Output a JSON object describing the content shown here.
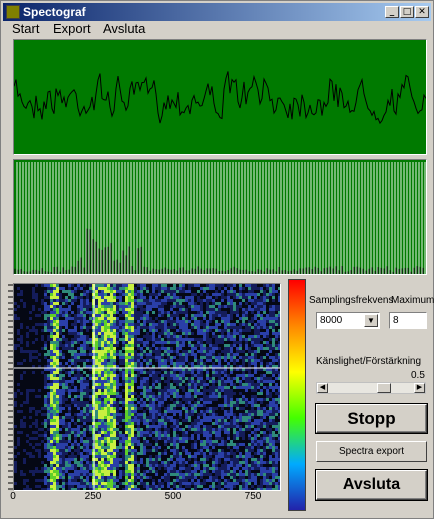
{
  "window": {
    "title": "Spectograf"
  },
  "titlebar_buttons": {
    "minimize": "_",
    "maximize": "□",
    "close": "✕"
  },
  "menu": {
    "items": [
      "Start",
      "Export",
      "Avsluta"
    ]
  },
  "controls": {
    "sampling_label": "Samplingsfrekvens",
    "maximum_label": "Maximum",
    "sampling_value": "8000",
    "maximum_value": "8",
    "sensitivity_label": "Känslighet/Förstärkning",
    "sensitivity_value": "0.5",
    "stop_button": "Stopp",
    "spectra_export_button": "Spectra export",
    "avsluta_button": "Avsluta"
  },
  "spectrogram": {
    "x_ticks": [
      "0",
      "250",
      "500",
      "750"
    ]
  },
  "colors": {
    "plot_bg": "#007a00",
    "window_bg": "#d4d0c8"
  }
}
